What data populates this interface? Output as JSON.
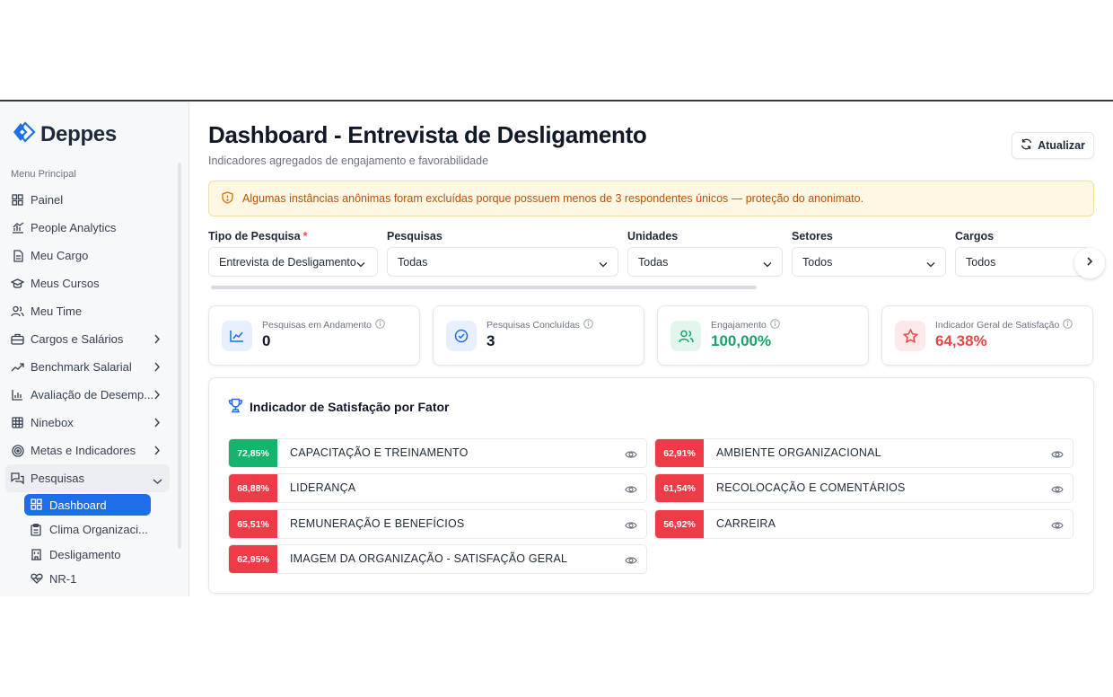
{
  "app": {
    "name": "Deppes",
    "brand_color": "#1d6ee8"
  },
  "sidebar": {
    "menu_title": "Menu Principal",
    "items": [
      {
        "label": "Painel",
        "icon": "grid-icon"
      },
      {
        "label": "People Analytics",
        "icon": "bar-chart-icon"
      },
      {
        "label": "Meu Cargo",
        "icon": "file-icon"
      },
      {
        "label": "Meus Cursos",
        "icon": "graduation-cap-icon"
      },
      {
        "label": "Meu Time",
        "icon": "users-icon"
      },
      {
        "label": "Cargos e Salários",
        "icon": "briefcase-icon"
      },
      {
        "label": "Benchmark Salarial",
        "icon": "trending-up-icon"
      },
      {
        "label": "Avaliação de Desemp...",
        "icon": "bar-chart-icon"
      },
      {
        "label": "Ninebox",
        "icon": "grid-nine-icon"
      },
      {
        "label": "Metas e Indicadores",
        "icon": "target-icon"
      },
      {
        "label": "Pesquisas",
        "icon": "chat-icon"
      }
    ],
    "subitems": [
      {
        "label": "Dashboard",
        "icon": "grid-icon"
      },
      {
        "label": "Clima Organizaci...",
        "icon": "clipboard-icon"
      },
      {
        "label": "Desligamento",
        "icon": "building-icon"
      },
      {
        "label": "NR-1",
        "icon": "heart-pulse-icon"
      }
    ]
  },
  "header": {
    "title": "Dashboard - Entrevista de Desligamento",
    "subtitle": "Indicadores agregados de engajamento e favorabilidade",
    "refresh_label": "Atualizar"
  },
  "alert": {
    "text": "Algumas instâncias anônimas foram excluídas porque possuem menos de 3 respondentes únicos — proteção do anonimato."
  },
  "filters": [
    {
      "label": "Tipo de Pesquisa",
      "required": "*",
      "value": "Entrevista de Desligamento"
    },
    {
      "label": "Pesquisas",
      "value": "Todas"
    },
    {
      "label": "Unidades",
      "value": "Todas"
    },
    {
      "label": "Setores",
      "value": "Todos"
    },
    {
      "label": "Cargos",
      "value": "Todos"
    }
  ],
  "kpis": [
    {
      "label": "Pesquisas em Andamento",
      "value": "0",
      "icon": "line-chart-icon",
      "color": "#111827"
    },
    {
      "label": "Pesquisas Concluídas",
      "value": "3",
      "icon": "check-circle-icon",
      "color": "#111827"
    },
    {
      "label": "Engajamento",
      "value": "100,00%",
      "icon": "users-icon",
      "color": "#16a36a"
    },
    {
      "label": "Indicador Geral de Satisfação",
      "value": "64,38%",
      "icon": "star-icon",
      "color": "#ef4444"
    }
  ],
  "factors": {
    "title": "Indicador de Satisfação por Fator",
    "items": [
      {
        "pct": "72,85%",
        "name": "CAPACITAÇÃO E TREINAMENTO",
        "color": "#16b36c"
      },
      {
        "pct": "62,91%",
        "name": "AMBIENTE ORGANIZACIONAL",
        "color": "#ef3b48"
      },
      {
        "pct": "68,88%",
        "name": "LIDERANÇA",
        "color": "#ef3b48"
      },
      {
        "pct": "61,54%",
        "name": "RECOLOCAÇÃO E COMENTÁRIOS",
        "color": "#ef3b48"
      },
      {
        "pct": "65,51%",
        "name": "REMUNERAÇÃO E BENEFÍCIOS",
        "color": "#ef3b48"
      },
      {
        "pct": "56,92%",
        "name": "CARREIRA",
        "color": "#ef3b48"
      },
      {
        "pct": "62,95%",
        "name": "IMAGEM DA ORGANIZAÇÃO - SATISFAÇÃO GERAL",
        "color": "#ef3b48"
      }
    ]
  }
}
